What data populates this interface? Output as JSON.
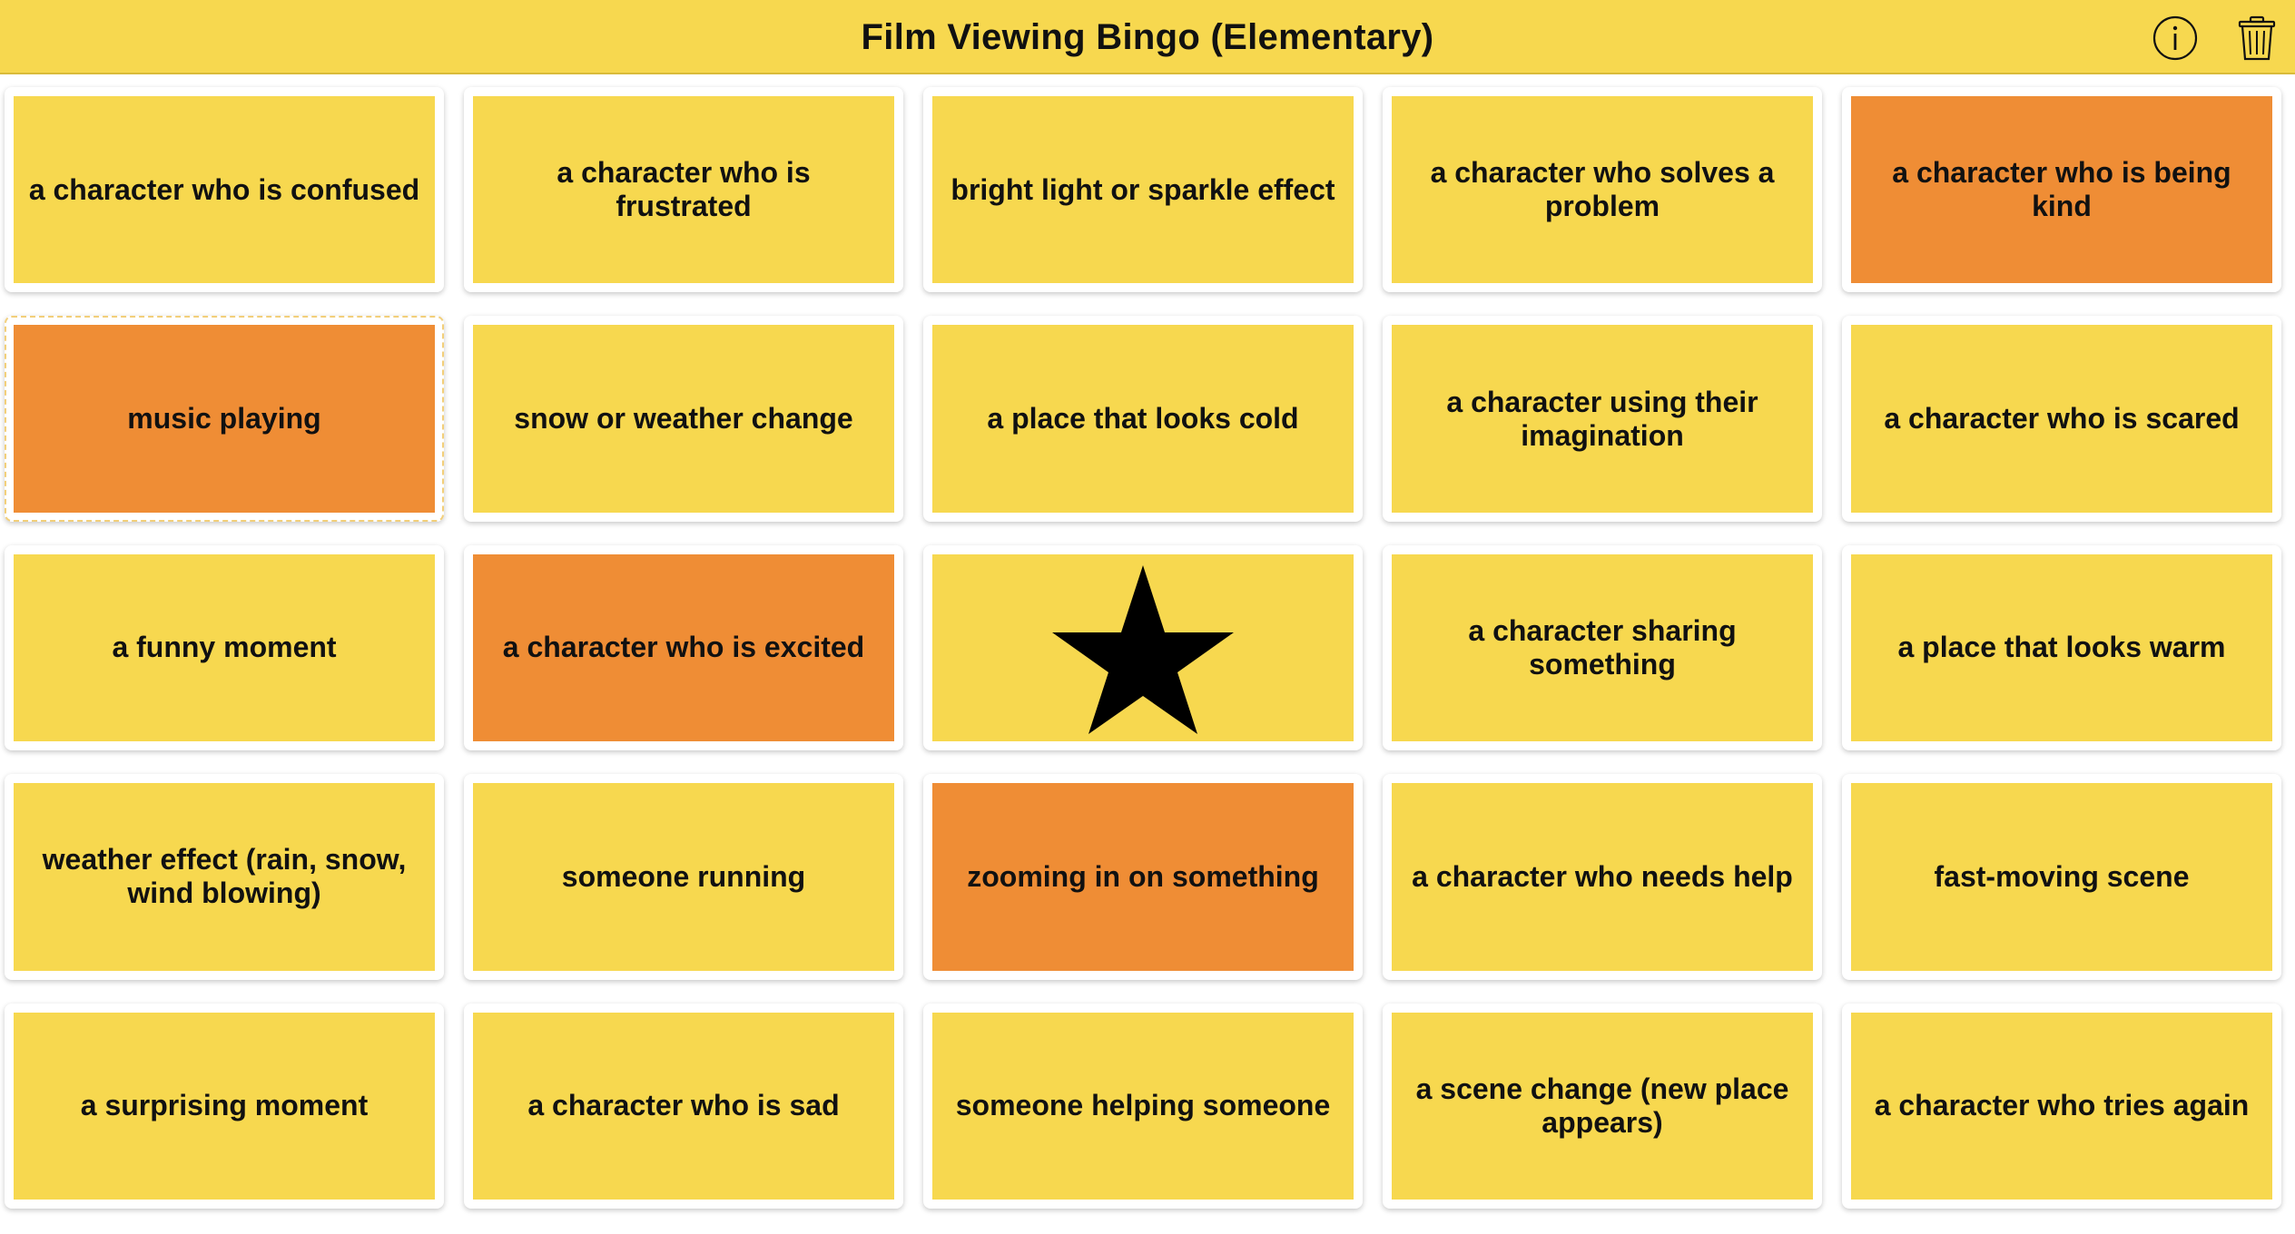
{
  "header": {
    "title": "Film Viewing Bingo (Elementary)",
    "info_icon": "info-icon",
    "trash_icon": "trash-icon"
  },
  "colors": {
    "unmarked": "#f7d84f",
    "marked": "#ef8d35",
    "header_bg": "#f7d84f"
  },
  "board": {
    "cells": [
      {
        "label": "a character who is confused",
        "marked": false
      },
      {
        "label": "a character who is frustrated",
        "marked": false
      },
      {
        "label": "bright light or sparkle effect",
        "marked": false
      },
      {
        "label": "a character who solves a problem",
        "marked": false
      },
      {
        "label": "a character who is being kind",
        "marked": true
      },
      {
        "label": "music playing",
        "marked": true
      },
      {
        "label": "snow or weather change",
        "marked": false
      },
      {
        "label": "a place that looks cold",
        "marked": false
      },
      {
        "label": "a character using their imagination",
        "marked": false
      },
      {
        "label": "a character who is scared",
        "marked": false
      },
      {
        "label": "a funny moment",
        "marked": false
      },
      {
        "label": "a character who is excited",
        "marked": true
      },
      {
        "label": "",
        "marked": false,
        "icon": "star-icon"
      },
      {
        "label": "a character sharing something",
        "marked": false
      },
      {
        "label": "a place that looks warm",
        "marked": false
      },
      {
        "label": "weather effect (rain, snow, wind blowing)",
        "marked": false
      },
      {
        "label": "someone running",
        "marked": false
      },
      {
        "label": "zooming in on something",
        "marked": true
      },
      {
        "label": "a character who needs help",
        "marked": false
      },
      {
        "label": "fast-moving scene",
        "marked": false
      },
      {
        "label": "a surprising moment",
        "marked": false
      },
      {
        "label": "a character who is sad",
        "marked": false
      },
      {
        "label": "someone helping someone",
        "marked": false
      },
      {
        "label": "a scene change (new place appears)",
        "marked": false
      },
      {
        "label": "a character who tries again",
        "marked": false
      }
    ]
  }
}
